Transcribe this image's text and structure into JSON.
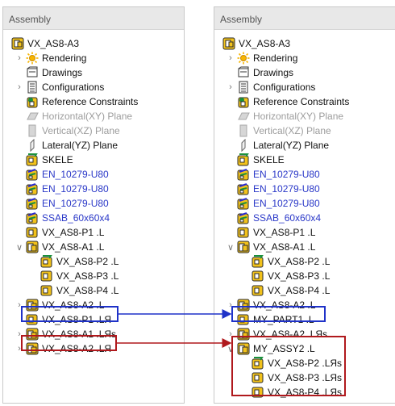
{
  "left_panel": {
    "title": "Assembly",
    "items": [
      {
        "label": "VX_AS8-A3",
        "icon": "assembly-icon",
        "indent": 0,
        "expander": "none",
        "style": "normal"
      },
      {
        "label": "Rendering",
        "icon": "rendering-sun-icon",
        "indent": 1,
        "expander": "collapsed",
        "style": "normal"
      },
      {
        "label": "Drawings",
        "icon": "drawings-icon",
        "indent": 1,
        "expander": "none",
        "style": "normal"
      },
      {
        "label": "Configurations",
        "icon": "configurations-icon",
        "indent": 1,
        "expander": "collapsed",
        "style": "normal"
      },
      {
        "label": "Reference Constraints",
        "icon": "reference-constraints-icon",
        "indent": 1,
        "expander": "none",
        "style": "normal"
      },
      {
        "label": "Horizontal(XY) Plane",
        "icon": "horizontal-plane-icon",
        "indent": 1,
        "expander": "none",
        "style": "grey"
      },
      {
        "label": "Vertical(XZ) Plane",
        "icon": "vertical-plane-icon",
        "indent": 1,
        "expander": "none",
        "style": "grey"
      },
      {
        "label": "Lateral(YZ) Plane",
        "icon": "lateral-plane-icon",
        "indent": 1,
        "expander": "none",
        "style": "normal"
      },
      {
        "label": "SKELE",
        "icon": "skeleton-part-icon",
        "indent": 1,
        "expander": "none",
        "style": "normal"
      },
      {
        "label": "EN_10279-U80",
        "icon": "profile-part-icon",
        "indent": 1,
        "expander": "none",
        "style": "blue"
      },
      {
        "label": "EN_10279-U80",
        "icon": "profile-part-icon",
        "indent": 1,
        "expander": "none",
        "style": "blue"
      },
      {
        "label": "EN_10279-U80",
        "icon": "profile-part-icon",
        "indent": 1,
        "expander": "none",
        "style": "blue"
      },
      {
        "label": "SSAB_60x60x4",
        "icon": "profile-part-icon",
        "indent": 1,
        "expander": "none",
        "style": "blue"
      },
      {
        "label": "VX_AS8-P1 .L",
        "icon": "part-icon",
        "indent": 1,
        "expander": "none",
        "style": "normal"
      },
      {
        "label": "VX_AS8-A1 .L",
        "icon": "subassembly-icon",
        "indent": 1,
        "expander": "expanded",
        "style": "normal"
      },
      {
        "label": "VX_AS8-P2 .L",
        "icon": "skeleton-part-icon",
        "indent": 2,
        "expander": "none",
        "style": "normal"
      },
      {
        "label": "VX_AS8-P3 .L",
        "icon": "part-icon",
        "indent": 2,
        "expander": "none",
        "style": "normal"
      },
      {
        "label": "VX_AS8-P4 .L",
        "icon": "part-icon",
        "indent": 2,
        "expander": "none",
        "style": "normal"
      },
      {
        "label": "VX_AS8-A2 .L",
        "icon": "subassembly-icon",
        "indent": 1,
        "expander": "collapsed",
        "style": "normal"
      },
      {
        "label": "VX_AS8-P1 .LЯ",
        "icon": "part-icon",
        "indent": 1,
        "expander": "none",
        "style": "normal"
      },
      {
        "label": "VX_AS8-A1 .LЯs",
        "icon": "subassembly-icon",
        "indent": 1,
        "expander": "collapsed",
        "style": "normal"
      },
      {
        "label": "VX_AS8-A2 .LЯ",
        "icon": "subassembly-icon",
        "indent": 1,
        "expander": "collapsed",
        "style": "normal"
      }
    ]
  },
  "right_panel": {
    "title": "Assembly",
    "items": [
      {
        "label": "VX_AS8-A3",
        "icon": "assembly-icon",
        "indent": 0,
        "expander": "none",
        "style": "normal"
      },
      {
        "label": "Rendering",
        "icon": "rendering-sun-icon",
        "indent": 1,
        "expander": "collapsed",
        "style": "normal"
      },
      {
        "label": "Drawings",
        "icon": "drawings-icon",
        "indent": 1,
        "expander": "none",
        "style": "normal"
      },
      {
        "label": "Configurations",
        "icon": "configurations-icon",
        "indent": 1,
        "expander": "collapsed",
        "style": "normal"
      },
      {
        "label": "Reference Constraints",
        "icon": "reference-constraints-icon",
        "indent": 1,
        "expander": "none",
        "style": "normal"
      },
      {
        "label": "Horizontal(XY) Plane",
        "icon": "horizontal-plane-icon",
        "indent": 1,
        "expander": "none",
        "style": "grey"
      },
      {
        "label": "Vertical(XZ) Plane",
        "icon": "vertical-plane-icon",
        "indent": 1,
        "expander": "none",
        "style": "grey"
      },
      {
        "label": "Lateral(YZ) Plane",
        "icon": "lateral-plane-icon",
        "indent": 1,
        "expander": "none",
        "style": "normal"
      },
      {
        "label": "SKELE",
        "icon": "skeleton-part-icon",
        "indent": 1,
        "expander": "none",
        "style": "normal"
      },
      {
        "label": "EN_10279-U80",
        "icon": "profile-part-icon",
        "indent": 1,
        "expander": "none",
        "style": "blue"
      },
      {
        "label": "EN_10279-U80",
        "icon": "profile-part-icon",
        "indent": 1,
        "expander": "none",
        "style": "blue"
      },
      {
        "label": "EN_10279-U80",
        "icon": "profile-part-icon",
        "indent": 1,
        "expander": "none",
        "style": "blue"
      },
      {
        "label": "SSAB_60x60x4",
        "icon": "profile-part-icon",
        "indent": 1,
        "expander": "none",
        "style": "blue"
      },
      {
        "label": "VX_AS8-P1 .L",
        "icon": "part-icon",
        "indent": 1,
        "expander": "none",
        "style": "normal"
      },
      {
        "label": "VX_AS8-A1 .L",
        "icon": "subassembly-icon",
        "indent": 1,
        "expander": "expanded",
        "style": "normal"
      },
      {
        "label": "VX_AS8-P2 .L",
        "icon": "skeleton-part-icon",
        "indent": 2,
        "expander": "none",
        "style": "normal"
      },
      {
        "label": "VX_AS8-P3 .L",
        "icon": "part-icon",
        "indent": 2,
        "expander": "none",
        "style": "normal"
      },
      {
        "label": "VX_AS8-P4 .L",
        "icon": "part-icon",
        "indent": 2,
        "expander": "none",
        "style": "normal"
      },
      {
        "label": "VX_AS8-A2 .L",
        "icon": "subassembly-icon",
        "indent": 1,
        "expander": "collapsed",
        "style": "normal"
      },
      {
        "label": "MY_PART1 .L",
        "icon": "part-icon",
        "indent": 1,
        "expander": "none",
        "style": "normal"
      },
      {
        "label": "VX_AS8-A2 .LЯs",
        "icon": "subassembly-icon",
        "indent": 1,
        "expander": "collapsed",
        "style": "normal"
      },
      {
        "label": "MY_ASSY2 .L",
        "icon": "subassembly-icon",
        "indent": 1,
        "expander": "expanded",
        "style": "normal"
      },
      {
        "label": "VX_AS8-P2 .LЯs",
        "icon": "skeleton-part-icon",
        "indent": 2,
        "expander": "none",
        "style": "normal"
      },
      {
        "label": "VX_AS8-P3 .LЯs",
        "icon": "part-icon",
        "indent": 2,
        "expander": "none",
        "style": "normal"
      },
      {
        "label": "VX_AS8-P4 .LЯs",
        "icon": "part-icon",
        "indent": 2,
        "expander": "none",
        "style": "normal"
      }
    ]
  },
  "annotations": {
    "blue_color": "#1f32c8",
    "red_color": "#b0191d",
    "blue_link": {
      "from": "VX_AS8-P1 .LЯ",
      "to": "MY_PART1 .L"
    },
    "red_link": {
      "from": "VX_AS8-A2 .LЯ",
      "to": "MY_ASSY2 .L"
    }
  }
}
